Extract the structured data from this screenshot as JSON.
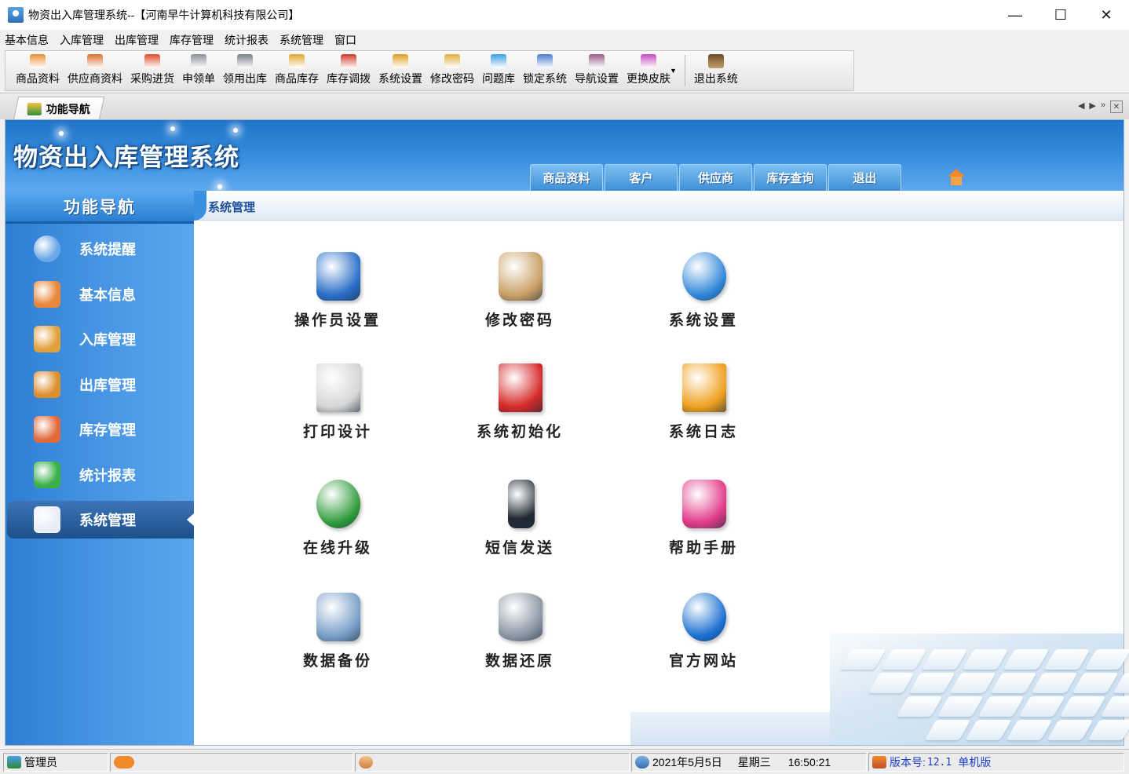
{
  "window": {
    "title": "物资出入库管理系统--【河南早牛计算机科技有限公司】",
    "minimize": "—",
    "maximize": "☐",
    "close": "✕"
  },
  "menubar": [
    "基本信息",
    "入库管理",
    "出库管理",
    "库存管理",
    "统计报表",
    "系统管理",
    "窗口"
  ],
  "toolbar": {
    "buttons": [
      {
        "label": "商品资料",
        "icon": "goods-icon",
        "color": "#e8903a"
      },
      {
        "label": "供应商资料",
        "icon": "supplier-icon",
        "color": "#d9702a"
      },
      {
        "label": "采购进货",
        "icon": "truck-icon",
        "color": "#e24b2e"
      },
      {
        "label": "申领单",
        "icon": "form-icon",
        "color": "#8a8f9a"
      },
      {
        "label": "领用出库",
        "icon": "cart-icon",
        "color": "#7a7f88"
      },
      {
        "label": "商品库存",
        "icon": "box-icon",
        "color": "#e0a830"
      },
      {
        "label": "库存调拨",
        "icon": "transfer-icon",
        "color": "#d23a2a"
      },
      {
        "label": "系统设置",
        "icon": "settings-icon",
        "color": "#e0a020"
      },
      {
        "label": "修改密码",
        "icon": "key-icon",
        "color": "#e2b040"
      },
      {
        "label": "问题库",
        "icon": "question-icon",
        "color": "#3aa0e6"
      },
      {
        "label": "锁定系统",
        "icon": "lock-icon",
        "color": "#4a7fd0"
      },
      {
        "label": "导航设置",
        "icon": "nav-settings-icon",
        "color": "#9a5a8a"
      },
      {
        "label": "更换皮肤",
        "icon": "skin-icon",
        "color": "#c84ac0"
      }
    ],
    "exit": {
      "label": "退出系统",
      "icon": "exit-icon",
      "color": "#6a4a2a"
    },
    "dropdown_arrow": "▼"
  },
  "tab": {
    "label": "功能导航",
    "controls": {
      "prev": "◀",
      "next": "▶",
      "more": "»",
      "close": "✕"
    }
  },
  "banner": {
    "title": "物资出入库管理系统",
    "nav": [
      "商品资料",
      "客户",
      "供应商",
      "库存查询",
      "退出"
    ]
  },
  "sidebar": {
    "title": "功能导航",
    "items": [
      {
        "label": "系统提醒",
        "icon": "info-icon",
        "color": "#6aa8e8"
      },
      {
        "label": "基本信息",
        "icon": "cubes-icon",
        "color": "#e8863a"
      },
      {
        "label": "入库管理",
        "icon": "box-in-icon",
        "color": "#e2a03a"
      },
      {
        "label": "出库管理",
        "icon": "box-out-icon",
        "color": "#dc8f2e"
      },
      {
        "label": "库存管理",
        "icon": "warehouse-icon",
        "color": "#e26a3a"
      },
      {
        "label": "统计报表",
        "icon": "bar-chart-icon",
        "color": "#3ab04a"
      },
      {
        "label": "系统管理",
        "icon": "tools-icon",
        "color": "#e8eef6"
      }
    ],
    "active_index": 6
  },
  "content": {
    "title": "系统管理",
    "functions": [
      {
        "label": "操作员设置",
        "icon": "operators-icon",
        "color": "#2a6fc8"
      },
      {
        "label": "修改密码",
        "icon": "password-lock-icon",
        "color": "#c9a066"
      },
      {
        "label": "系统设置",
        "icon": "globe-laptop-icon",
        "color": "#2f86d8"
      },
      {
        "label": "打印设计",
        "icon": "printer-icon",
        "color": "#d6d6d6"
      },
      {
        "label": "系统初始化",
        "icon": "document-delete-icon",
        "color": "#d62a2a"
      },
      {
        "label": "系统日志",
        "icon": "log-calculator-icon",
        "color": "#f0a020"
      },
      {
        "label": "在线升级",
        "icon": "globe-download-icon",
        "color": "#2e9a3a"
      },
      {
        "label": "短信发送",
        "icon": "phone-icon",
        "color": "#222a34"
      },
      {
        "label": "帮助手册",
        "icon": "help-person-icon",
        "color": "#e23a8a"
      },
      {
        "label": "数据备份",
        "icon": "calendar-clock-icon",
        "color": "#7aa0c8"
      },
      {
        "label": "数据还原",
        "icon": "database-restore-icon",
        "color": "#8a96a4"
      },
      {
        "label": "官方网站",
        "icon": "ie-icon",
        "color": "#1a6fd0"
      }
    ]
  },
  "statusbar": {
    "user": "管理员",
    "date": "2021年5月5日",
    "weekday": "星期三",
    "time": "16:50:21",
    "version_label": "版本号:",
    "version": "12.1",
    "edition": "单机版"
  }
}
